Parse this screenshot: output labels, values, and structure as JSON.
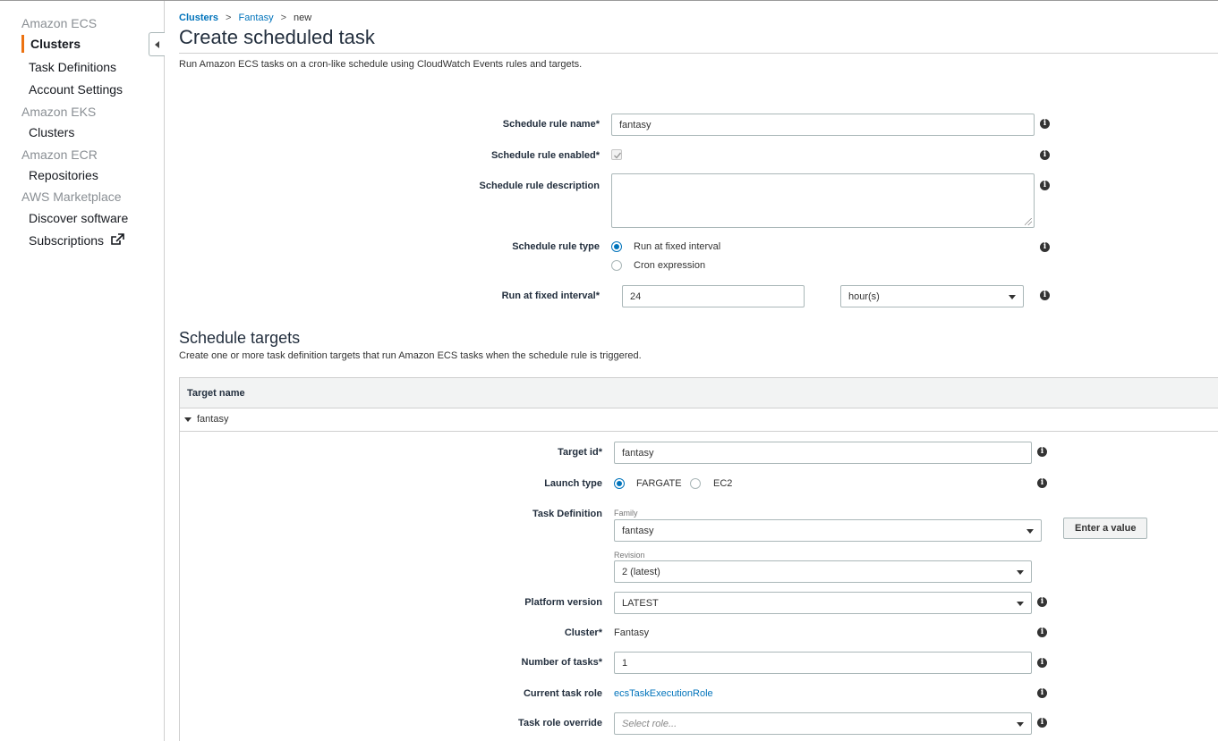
{
  "sidebar": {
    "sections": [
      {
        "title": "Amazon ECS",
        "items": [
          "Clusters",
          "Task Definitions",
          "Account Settings"
        ]
      },
      {
        "title": "Amazon EKS",
        "items": [
          "Clusters"
        ]
      },
      {
        "title": "Amazon ECR",
        "items": [
          "Repositories"
        ]
      },
      {
        "title": "AWS Marketplace",
        "items": [
          "Discover software",
          "Subscriptions"
        ]
      }
    ]
  },
  "breadcrumb": {
    "items": [
      "Clusters",
      "Fantasy",
      "new"
    ]
  },
  "page": {
    "title": "Create scheduled task",
    "subtitle": "Run Amazon ECS tasks on a cron-like schedule using CloudWatch Events rules and targets."
  },
  "rule": {
    "name_label": "Schedule rule name*",
    "name_value": "fantasy",
    "enabled_label": "Schedule rule enabled*",
    "description_label": "Schedule rule description",
    "type_label": "Schedule rule type",
    "type_options": [
      "Run at fixed interval",
      "Cron expression"
    ],
    "interval_label": "Run at fixed interval*",
    "interval_value": "24",
    "interval_unit": "hour(s)"
  },
  "targets": {
    "title": "Schedule targets",
    "subtitle": "Create one or more task definition targets that run Amazon ECS tasks when the schedule rule is triggered.",
    "column_header": "Target name",
    "row_name": "fantasy",
    "target_id_label": "Target id*",
    "target_id_value": "fantasy",
    "launch_type_label": "Launch type",
    "launch_options": [
      "FARGATE",
      "EC2"
    ],
    "task_def_label": "Task Definition",
    "family_label": "Family",
    "family_value": "fantasy",
    "enter_value_button": "Enter a value",
    "revision_label": "Revision",
    "revision_value": "2 (latest)",
    "platform_label": "Platform version",
    "platform_value": "LATEST",
    "cluster_label": "Cluster*",
    "cluster_value": "Fantasy",
    "num_tasks_label": "Number of tasks*",
    "num_tasks_value": "1",
    "current_role_label": "Current task role",
    "current_role_value": "ecsTaskExecutionRole",
    "role_override_label": "Task role override",
    "role_override_placeholder": "Select role..."
  },
  "info_glyph": "i",
  "colors": {
    "accent": "#ec7211",
    "link": "#0073bb"
  }
}
